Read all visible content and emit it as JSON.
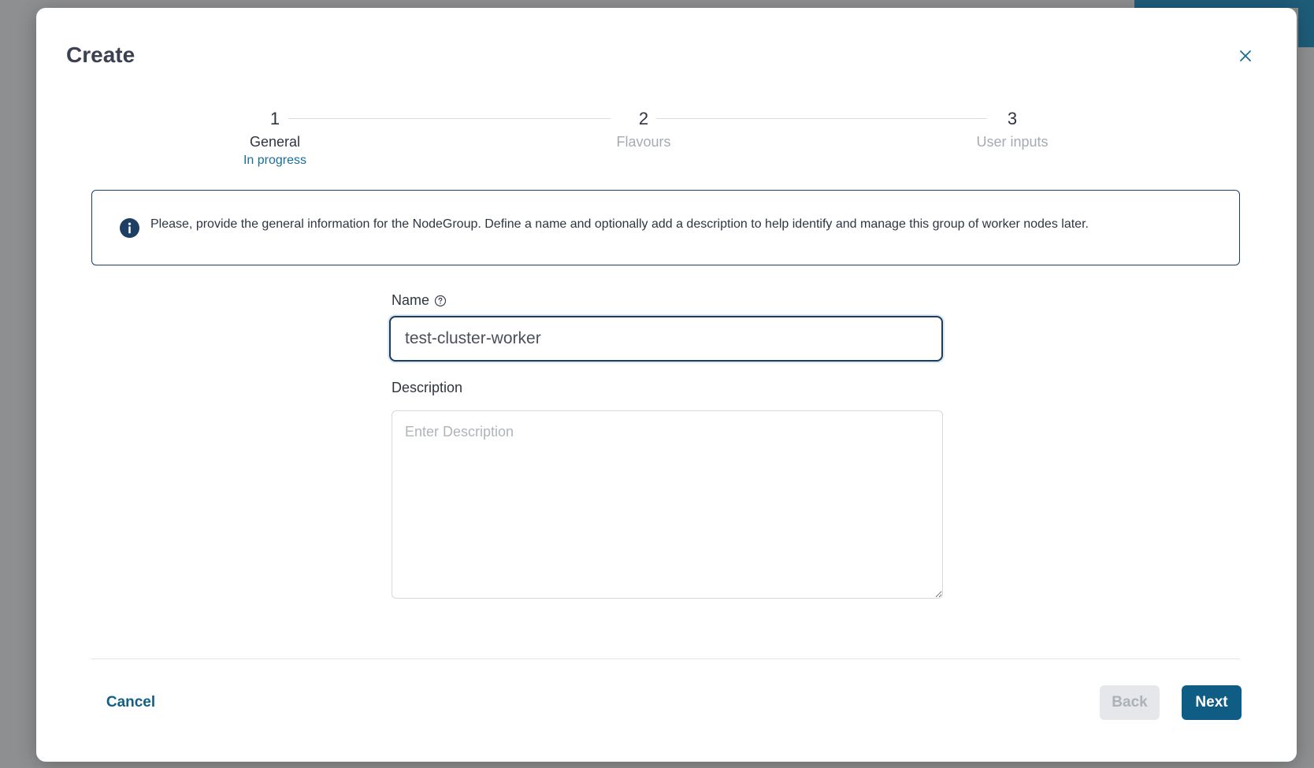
{
  "modal": {
    "title": "Create",
    "close_icon": "close-icon"
  },
  "stepper": {
    "steps": [
      {
        "number": "1",
        "label": "General",
        "status": "In progress",
        "active": true
      },
      {
        "number": "2",
        "label": "Flavours",
        "status": "",
        "active": false
      },
      {
        "number": "3",
        "label": "User inputs",
        "status": "",
        "active": false
      }
    ]
  },
  "info": {
    "icon": "info-icon",
    "text": "Please, provide the general information for the NodeGroup. Define a name and optionally add a description to help identify and manage this group of worker nodes later."
  },
  "form": {
    "name_label": "Name",
    "name_help_icon": "help-circle-icon",
    "name_value": "test-cluster-worker",
    "description_label": "Description",
    "description_placeholder": "Enter Description",
    "description_value": ""
  },
  "footer": {
    "cancel_label": "Cancel",
    "back_label": "Back",
    "next_label": "Next"
  },
  "colors": {
    "accent": "#0f5d85",
    "link": "#135f86",
    "info_border": "#1d3f64",
    "disabled_bg": "#e5e7ea"
  }
}
